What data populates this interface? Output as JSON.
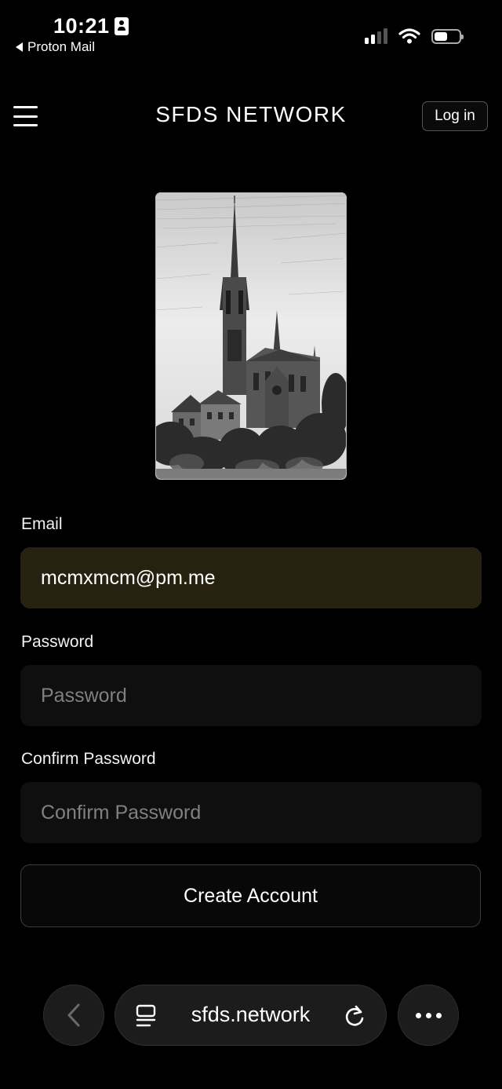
{
  "status_bar": {
    "time": "10:21",
    "back_app": "Proton Mail",
    "battery_level": 0.45,
    "signal_bars": 2
  },
  "nav": {
    "title": "SFDS NETWORK",
    "login_label": "Log in"
  },
  "hero": {
    "icon": "cathedral-sketch-image"
  },
  "form": {
    "email_label": "Email",
    "email_value": "mcmxmcm@pm.me",
    "password_label": "Password",
    "password_placeholder": "Password",
    "confirm_label": "Confirm Password",
    "confirm_placeholder": "Confirm Password",
    "submit_label": "Create Account"
  },
  "browser": {
    "url": "sfds.network"
  },
  "colors": {
    "background": "#000000",
    "autofill_field": "#26220f",
    "empty_field": "#0f0f0f"
  }
}
